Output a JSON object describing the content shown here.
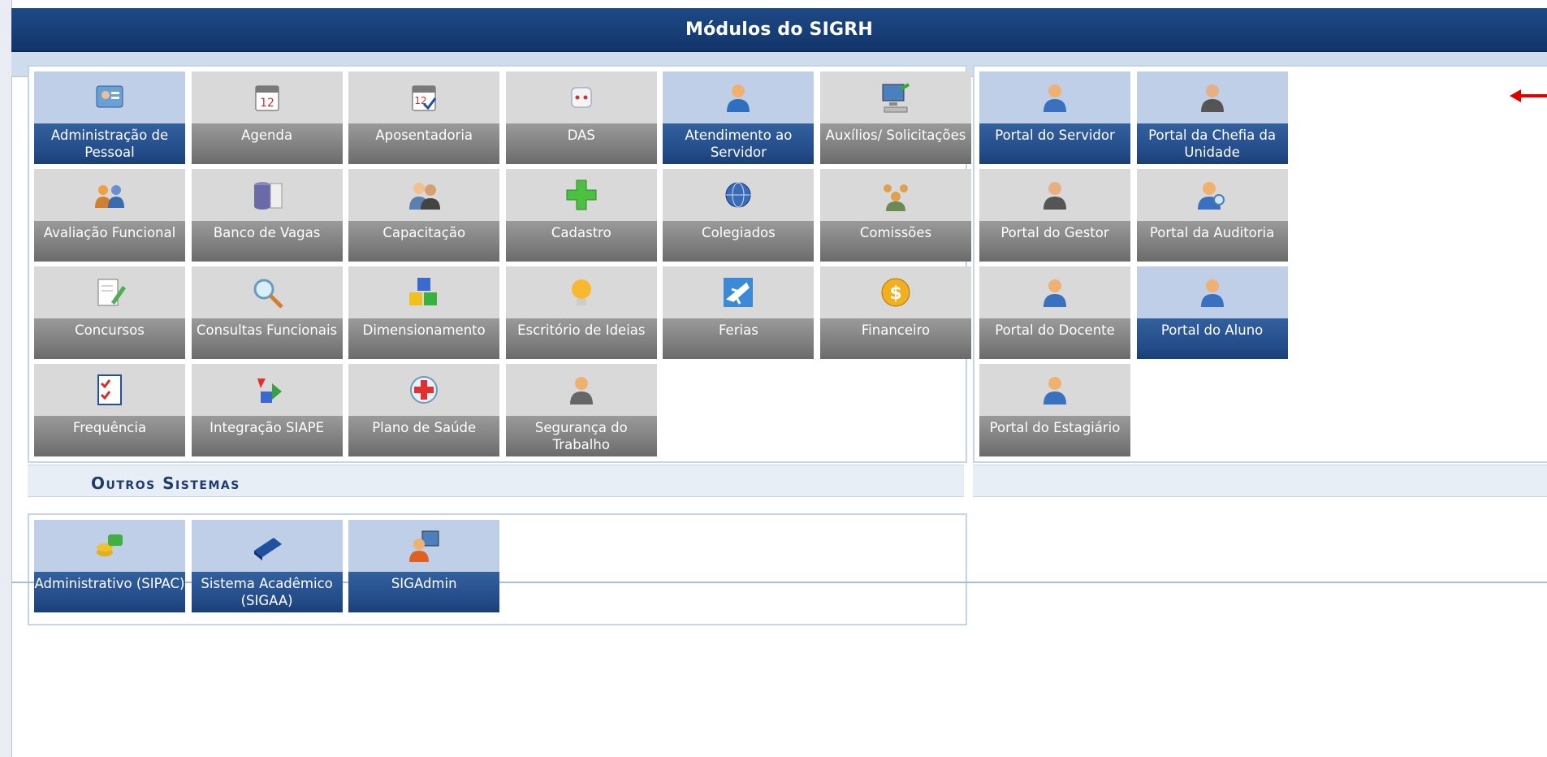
{
  "header": {
    "title": "Módulos do SIGRH"
  },
  "modules": [
    {
      "label": "Administração de Pessoal",
      "style": "blue",
      "icon": "person-card-icon"
    },
    {
      "label": "Agenda",
      "style": "gray",
      "icon": "calendar-icon"
    },
    {
      "label": "Aposentadoria",
      "style": "gray",
      "icon": "calendar-check-icon"
    },
    {
      "label": "DAS",
      "style": "gray",
      "icon": "die-icon"
    },
    {
      "label": "Atendimento ao Servidor",
      "style": "blue",
      "icon": "headset-person-icon"
    },
    {
      "label": "Auxílios/ Solicitações",
      "style": "gray",
      "icon": "computer-icon"
    },
    {
      "label": "Avaliação Funcional",
      "style": "gray",
      "icon": "two-people-icon"
    },
    {
      "label": "Banco de Vagas",
      "style": "gray",
      "icon": "database-table-icon"
    },
    {
      "label": "Capacitação",
      "style": "gray",
      "icon": "group-people-icon"
    },
    {
      "label": "Cadastro",
      "style": "gray",
      "icon": "plus-icon"
    },
    {
      "label": "Colegiados",
      "style": "gray",
      "icon": "globe-icon"
    },
    {
      "label": "Comissões",
      "style": "gray",
      "icon": "people-group-icon"
    },
    {
      "label": "Concursos",
      "style": "gray",
      "icon": "document-pencil-icon"
    },
    {
      "label": "Consultas Funcionais",
      "style": "gray",
      "icon": "magnifier-icon"
    },
    {
      "label": "Dimensionamento",
      "style": "gray",
      "icon": "cubes-icon"
    },
    {
      "label": "Escritório de Ideias",
      "style": "gray",
      "icon": "lightbulb-icon"
    },
    {
      "label": "Ferias",
      "style": "gray",
      "icon": "airplane-icon"
    },
    {
      "label": "Financeiro",
      "style": "gray",
      "icon": "dollar-coin-icon"
    },
    {
      "label": "Frequência",
      "style": "gray",
      "icon": "checklist-icon"
    },
    {
      "label": "Integração SIAPE",
      "style": "gray",
      "icon": "recycle-icon"
    },
    {
      "label": "Plano de Saúde",
      "style": "gray",
      "icon": "medical-cross-icon"
    },
    {
      "label": "Segurança do Trabalho",
      "style": "gray",
      "icon": "worker-helmet-icon"
    }
  ],
  "portals": [
    {
      "label": "Portal do Servidor",
      "style": "blue",
      "icon": "user-blue-icon"
    },
    {
      "label": "Portal da Chefia da Unidade",
      "style": "blue",
      "icon": "user-dark-icon"
    },
    {
      "label": "Portal do Gestor",
      "style": "gray",
      "icon": "user-dark-icon"
    },
    {
      "label": "Portal da Auditoria",
      "style": "gray",
      "icon": "user-search-icon"
    },
    {
      "label": "Portal do Docente",
      "style": "gray",
      "icon": "user-blue-icon"
    },
    {
      "label": "Portal do Aluno",
      "style": "blue",
      "icon": "user-blue-icon"
    },
    {
      "label": "Portal do Estagiário",
      "style": "gray",
      "icon": "user-blue-icon"
    }
  ],
  "other_section": {
    "title": "Outros Sistemas"
  },
  "other_systems": [
    {
      "label": "Administrativo (SIPAC)",
      "style": "blue",
      "icon": "coins-icon"
    },
    {
      "label": "Sistema Acadêmico (SIGAA)",
      "style": "blue",
      "icon": "book-icon"
    },
    {
      "label": "SIGAdmin",
      "style": "blue",
      "icon": "admin-computer-icon"
    }
  ],
  "colors": {
    "accent": "#1e4a86",
    "tile_blue": "#234c89",
    "tile_gray": "#7a7a7a",
    "arrow": "#e00000"
  }
}
